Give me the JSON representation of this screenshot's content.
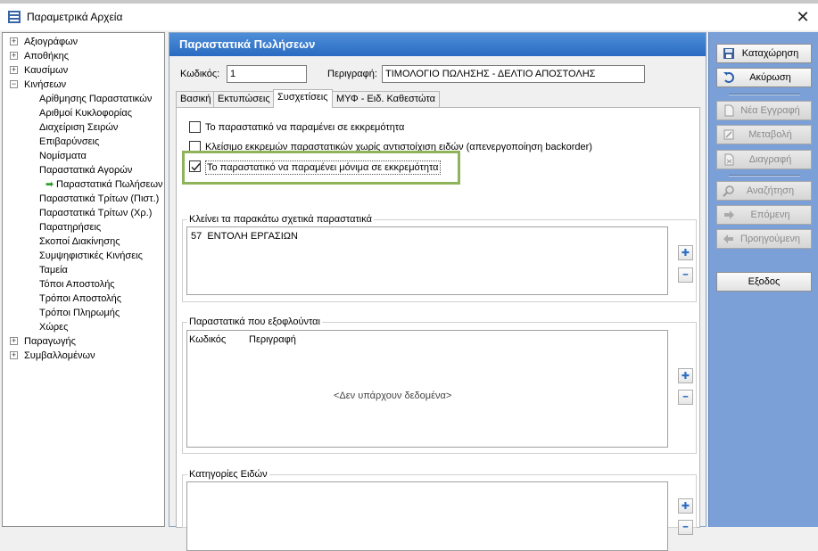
{
  "window": {
    "title": "Παραμετρικά Αρχεία",
    "close_glyph": "✕"
  },
  "tree": {
    "items": [
      {
        "label": "Αξιογράφων",
        "expander": "+"
      },
      {
        "label": "Αποθήκης",
        "expander": "+"
      },
      {
        "label": "Καυσίμων",
        "expander": "+"
      },
      {
        "label": "Κινήσεων",
        "expander": "−"
      },
      {
        "label": "Αρίθμησης Παραστατικών"
      },
      {
        "label": "Αριθμοί Κυκλοφορίας"
      },
      {
        "label": "Διαχείριση Σειρών"
      },
      {
        "label": "Επιβαρύνσεις"
      },
      {
        "label": "Νομίσματα"
      },
      {
        "label": "Παραστατικά Αγορών"
      },
      {
        "label": "Παραστατικά Πωλήσεων",
        "selected": true
      },
      {
        "label": "Παραστατικά Τρίτων (Πιστ.)"
      },
      {
        "label": "Παραστατικά Τρίτων (Χρ.)"
      },
      {
        "label": "Παρατηρήσεις"
      },
      {
        "label": "Σκοποί Διακίνησης"
      },
      {
        "label": "Συμψηφιστικές Κινήσεις"
      },
      {
        "label": "Ταμεία"
      },
      {
        "label": "Τόποι Αποστολής"
      },
      {
        "label": "Τρόποι Αποστολής"
      },
      {
        "label": "Τρόποι Πληρωμής"
      },
      {
        "label": "Χώρες"
      },
      {
        "label": "Παραγωγής",
        "expander": "+"
      },
      {
        "label": "Συμβαλλομένων",
        "expander": "+"
      }
    ]
  },
  "main": {
    "header": "Παραστατικά Πωλήσεων",
    "code_label": "Κωδικός:",
    "code_value": "1",
    "desc_label": "Περιγραφή:",
    "desc_value": "ΤΙΜΟΛΟΓΙΟ ΠΩΛΗΣΗΣ - ΔΕΛΤΙΟ ΑΠΟΣΤΟΛΗΣ",
    "tabs": [
      "Βασική",
      "Εκτυπώσεις",
      "Συσχετίσεις",
      "ΜΥΦ - Ειδ. Καθεστώτα"
    ],
    "active_tab": "Συσχετίσεις",
    "checkboxes": [
      {
        "label": "Το παραστατικό να παραμένει σε εκκρεμότητα",
        "checked": false
      },
      {
        "label": "Κλείσιμο εκκρεμών παραστατικών χωρίς αντιστοίχιση ειδών (απενεργοποίηση backorder)",
        "checked": false
      },
      {
        "label": "Το παραστατικό να παραμένει μόνιμα σε εκκρεμότητα",
        "checked": true
      }
    ],
    "group_close": {
      "title": "Κλείνει τα παρακάτω σχετικά παραστατικά",
      "items": [
        "57  ΕΝΤΟΛΗ ΕΡΓΑΣΙΩΝ"
      ]
    },
    "group_settle": {
      "title": "Παραστατικά που εξοφλούνται",
      "col_code": "Κωδικός",
      "col_desc": "Περιγραφή",
      "empty": "<Δεν υπάρχουν δεδομένα>"
    },
    "group_categories": {
      "title": "Κατηγορίες Ειδών"
    },
    "add_glyph": "✚",
    "remove_glyph": "━"
  },
  "actions": {
    "save": "Καταχώρηση",
    "cancel": "Ακύρωση",
    "new_record": "Νέα Εγγραφή",
    "edit": "Μεταβολή",
    "delete": "Διαγραφή",
    "search": "Αναζήτηση",
    "next": "Επόμενη",
    "previous": "Προηγούμενη",
    "exit": "Εξοδος"
  },
  "colors": {
    "header_blue": "#2a6bc2",
    "right_panel": "#7ba0d8",
    "highlight": "#8fb35a"
  }
}
